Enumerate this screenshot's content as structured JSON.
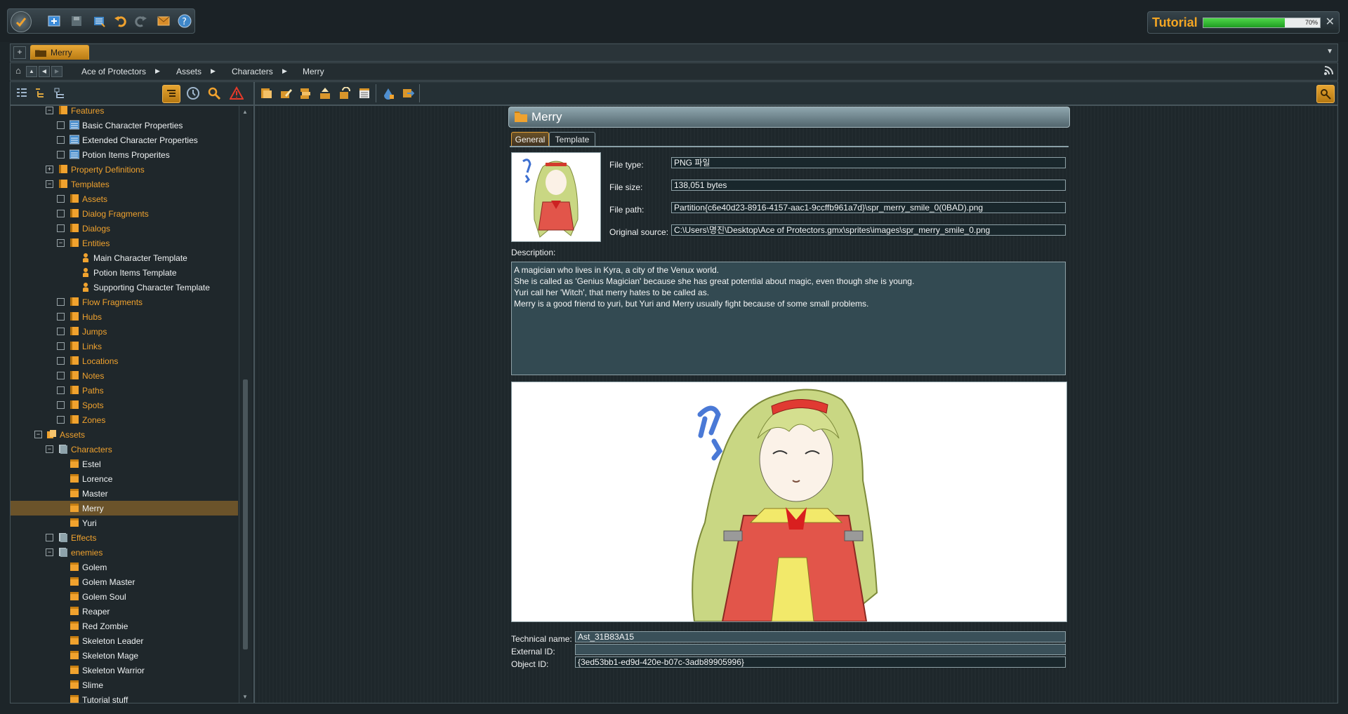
{
  "topbar": {
    "tutorial_title": "Tutorial",
    "tutorial_progress_label": "70%",
    "tutorial_progress": 0.7,
    "close_glyph": "✕"
  },
  "tabs": {
    "add_label": "+",
    "active_tab": "Merry",
    "menu_glyph": "▼"
  },
  "breadcrumb": {
    "items": [
      "Ace of Protectors",
      "Assets",
      "Characters",
      "Merry"
    ]
  },
  "tree": {
    "rows": [
      {
        "label": "Features",
        "kind": "folder",
        "expander": "−",
        "color": "orange"
      },
      {
        "label": "Basic Character Properties",
        "kind": "form",
        "expander": "",
        "color": "white"
      },
      {
        "label": "Extended Character Properties",
        "kind": "form",
        "expander": "",
        "color": "white"
      },
      {
        "label": "Potion Items Properites",
        "kind": "form",
        "expander": "",
        "color": "white"
      },
      {
        "label": "Property Definitions",
        "kind": "folder",
        "expander": "+",
        "color": "orange"
      },
      {
        "label": "Templates",
        "kind": "folder",
        "expander": "−",
        "color": "orange"
      },
      {
        "label": "Assets",
        "kind": "folder",
        "expander": "",
        "color": "orange"
      },
      {
        "label": "Dialog Fragments",
        "kind": "folder",
        "expander": "",
        "color": "orange"
      },
      {
        "label": "Dialogs",
        "kind": "folder",
        "expander": "",
        "color": "orange"
      },
      {
        "label": "Entities",
        "kind": "folder",
        "expander": "−",
        "color": "orange"
      },
      {
        "label": "Main Character Template",
        "kind": "person",
        "expander": "",
        "color": "white"
      },
      {
        "label": "Potion Items Template",
        "kind": "person",
        "expander": "",
        "color": "white"
      },
      {
        "label": "Supporting Character Template",
        "kind": "person",
        "expander": "",
        "color": "white"
      },
      {
        "label": "Flow Fragments",
        "kind": "folder",
        "expander": "",
        "color": "orange"
      },
      {
        "label": "Hubs",
        "kind": "folder",
        "expander": "",
        "color": "orange"
      },
      {
        "label": "Jumps",
        "kind": "folder",
        "expander": "",
        "color": "orange"
      },
      {
        "label": "Links",
        "kind": "folder",
        "expander": "",
        "color": "orange"
      },
      {
        "label": "Locations",
        "kind": "folder",
        "expander": "",
        "color": "orange"
      },
      {
        "label": "Notes",
        "kind": "folder",
        "expander": "",
        "color": "orange"
      },
      {
        "label": "Paths",
        "kind": "folder",
        "expander": "",
        "color": "orange"
      },
      {
        "label": "Spots",
        "kind": "folder",
        "expander": "",
        "color": "orange"
      },
      {
        "label": "Zones",
        "kind": "folder",
        "expander": "",
        "color": "orange"
      },
      {
        "label": "Assets",
        "kind": "assets",
        "expander": "−",
        "color": "orange"
      },
      {
        "label": "Characters",
        "kind": "pages",
        "expander": "−",
        "color": "orange"
      },
      {
        "label": "Estel",
        "kind": "asset",
        "expander": "",
        "color": "white"
      },
      {
        "label": "Lorence",
        "kind": "asset",
        "expander": "",
        "color": "white"
      },
      {
        "label": "Master",
        "kind": "asset",
        "expander": "",
        "color": "white"
      },
      {
        "label": "Merry",
        "kind": "asset",
        "expander": "",
        "color": "white",
        "selected": true
      },
      {
        "label": "Yuri",
        "kind": "asset",
        "expander": "",
        "color": "white"
      },
      {
        "label": "Effects",
        "kind": "pages",
        "expander": "",
        "color": "orange"
      },
      {
        "label": "enemies",
        "kind": "pages",
        "expander": "−",
        "color": "orange"
      },
      {
        "label": "Golem",
        "kind": "asset",
        "expander": "",
        "color": "white"
      },
      {
        "label": "Golem Master",
        "kind": "asset",
        "expander": "",
        "color": "white"
      },
      {
        "label": "Golem Soul",
        "kind": "asset",
        "expander": "",
        "color": "white"
      },
      {
        "label": "Reaper",
        "kind": "asset",
        "expander": "",
        "color": "white"
      },
      {
        "label": "Red Zombie",
        "kind": "asset",
        "expander": "",
        "color": "white"
      },
      {
        "label": "Skeleton Leader",
        "kind": "asset",
        "expander": "",
        "color": "white"
      },
      {
        "label": "Skeleton Mage",
        "kind": "asset",
        "expander": "",
        "color": "white"
      },
      {
        "label": "Skeleton Warrior",
        "kind": "asset",
        "expander": "",
        "color": "white"
      },
      {
        "label": "Slime",
        "kind": "asset",
        "expander": "",
        "color": "white"
      },
      {
        "label": "Tutorial stuff",
        "kind": "asset",
        "expander": "",
        "color": "white"
      }
    ]
  },
  "entity": {
    "title": "Merry",
    "tab_general": "General",
    "tab_template": "Template",
    "file_type_label": "File type:",
    "file_type": "PNG 파일",
    "file_size_label": "File size:",
    "file_size": "138,051 bytes",
    "file_path_label": "File path:",
    "file_path": "Partition{c6e40d23-8916-4157-aac1-9ccffb961a7d}\\spr_merry_smile_0(0BAD).png",
    "original_source_label": "Original source:",
    "original_source": "C:\\Users\\명진\\Desktop\\Ace of Protectors.gmx\\sprites\\images\\spr_merry_smile_0.png",
    "description_label": "Description:",
    "description_lines": [
      "A magician who lives in Kyra, a city of the Venux world.",
      "She is called as 'Genius Magician' because she has great potential about magic, even though she is young.",
      "Yuri call her 'Witch', that merry hates to be called as.",
      "Merry is a good friend to yuri, but Yuri and Merry usually fight because of some small problems."
    ],
    "technical_name_label": "Technical name:",
    "technical_name": "Ast_31B83A15",
    "external_id_label": "External ID:",
    "external_id": "",
    "object_id_label": "Object ID:",
    "object_id": "{3ed53bb1-ed9d-420e-b07c-3adb89905996}"
  },
  "colors": {
    "accent": "#f0a22e",
    "selected_row": "#6b532a",
    "progress": "#2fbf2f"
  }
}
